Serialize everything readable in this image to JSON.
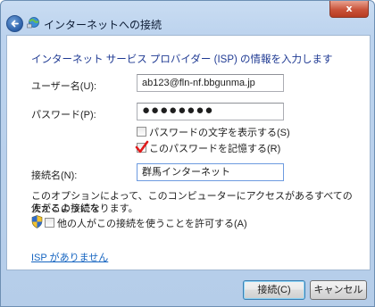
{
  "window": {
    "title": "インターネットへの接続",
    "close_label": "x",
    "icons": {
      "back": "back-arrow-icon",
      "app": "network-connection-icon",
      "close": "close-icon"
    }
  },
  "form": {
    "heading": "インターネット サービス プロバイダー (ISP) の情報を入力します",
    "username_label": "ユーザー名(U):",
    "username_value": "ab123@fln-nf.bbgunma.jp",
    "password_label": "パスワード(P):",
    "password_value": "●●●●●●●●",
    "show_password_label": "パスワードの文字を表示する(S)",
    "show_password_checked": false,
    "remember_password_label": "このパスワードを記憶する(R)",
    "remember_password_checked": true,
    "connection_name_label": "接続名(N):",
    "connection_name_value": "群馬インターネット",
    "note_line1": "このオプションによって、このコンピューターにアクセスがあるすべての人がこの接続を",
    "note_line2": "使えるようになります。",
    "allow_others_label": "他の人がこの接続を使うことを許可する(A)",
    "allow_others_checked": false,
    "no_isp_link": "ISP がありません"
  },
  "buttons": {
    "connect_label": "接続(C)",
    "cancel_label": "キャンセル"
  },
  "colors": {
    "heading": "#1f3a93",
    "link": "#1665c1",
    "checkmark": "#e01b1b"
  }
}
